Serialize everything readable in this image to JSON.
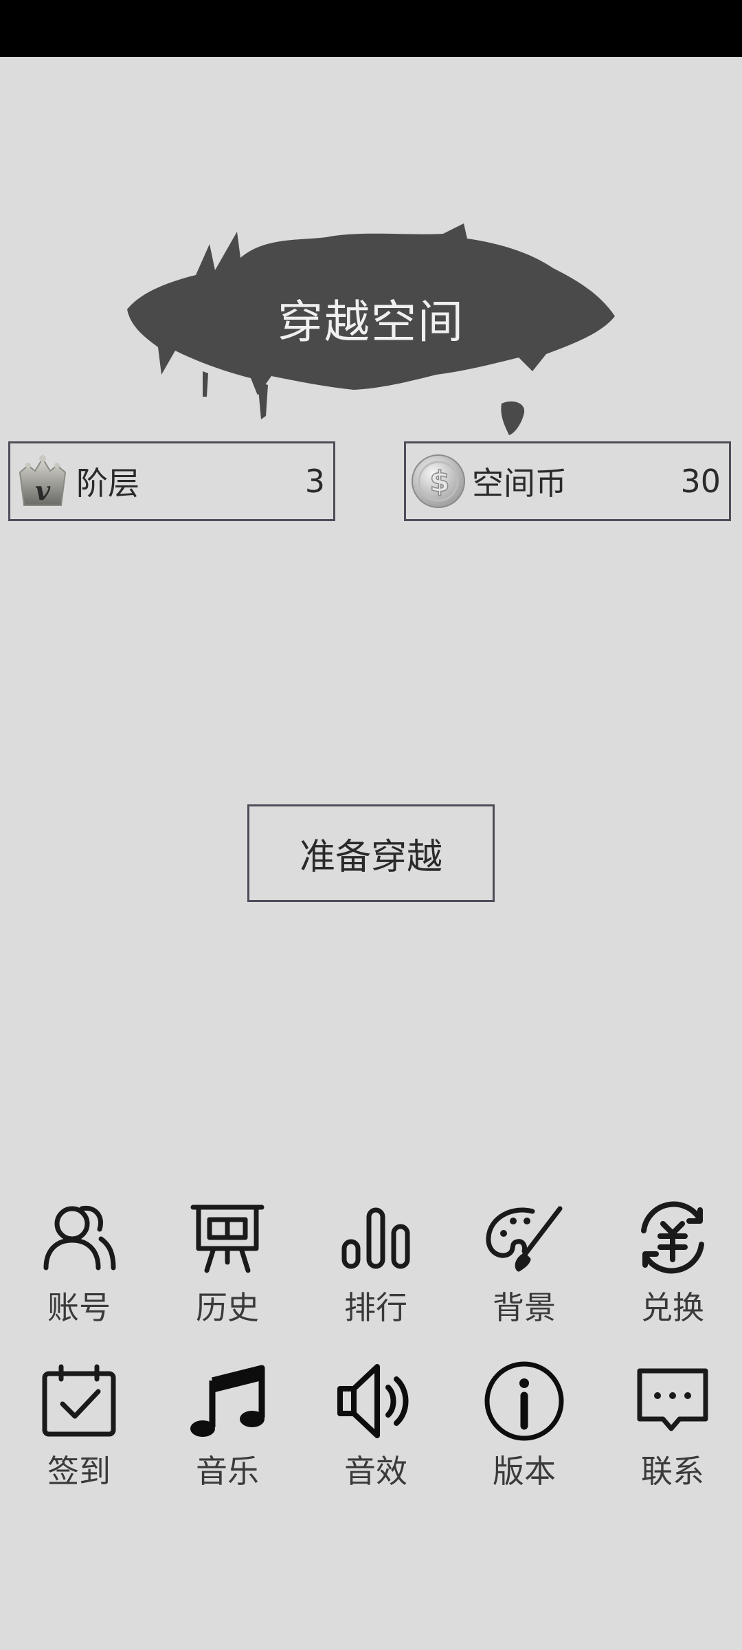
{
  "title": "穿越空间",
  "stats": {
    "level": {
      "label": "阶层",
      "value": "3",
      "icon": "crown-v-icon"
    },
    "coins": {
      "label": "空间币",
      "value": "30",
      "icon": "silver-coin-icon"
    }
  },
  "prepare_button": "准备穿越",
  "menu": {
    "row1": [
      {
        "label": "账号",
        "icon": "users-icon"
      },
      {
        "label": "历史",
        "icon": "easel-icon"
      },
      {
        "label": "排行",
        "icon": "bar-chart-icon"
      },
      {
        "label": "背景",
        "icon": "palette-icon"
      },
      {
        "label": "兑换",
        "icon": "exchange-icon"
      }
    ],
    "row2": [
      {
        "label": "签到",
        "icon": "calendar-check-icon"
      },
      {
        "label": "音乐",
        "icon": "music-note-icon"
      },
      {
        "label": "音效",
        "icon": "speaker-icon"
      },
      {
        "label": "版本",
        "icon": "info-icon"
      },
      {
        "label": "联系",
        "icon": "chat-icon"
      }
    ]
  },
  "colors": {
    "background": "#dcdcdc",
    "ink": "#4a4a4a",
    "border": "#4d4d5a",
    "text": "#2a2a2a"
  }
}
